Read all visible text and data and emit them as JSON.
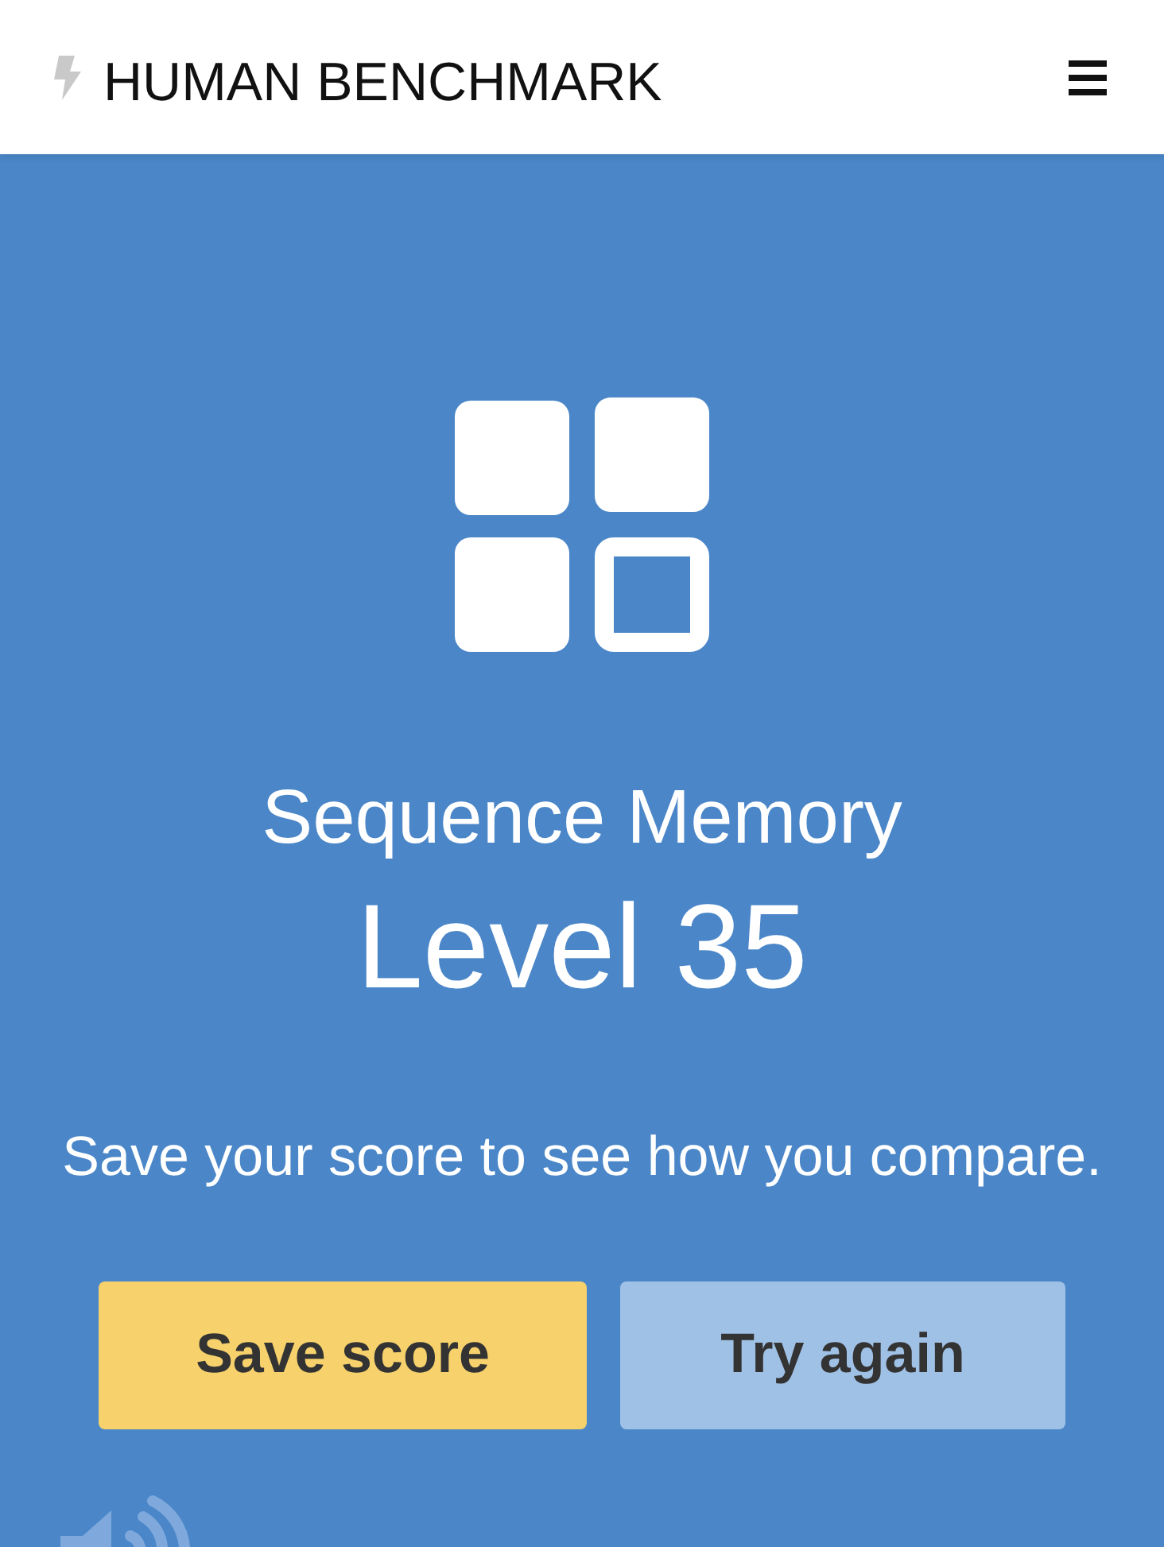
{
  "navbar": {
    "brand": "HUMAN BENCHMARK"
  },
  "result": {
    "test_name": "Sequence Memory",
    "score": "Level 35",
    "prompt": "Save your score to see how you compare."
  },
  "buttons": [
    {
      "label": "Save score",
      "kind": "primary"
    },
    {
      "label": "Try again",
      "kind": "secondary"
    }
  ]
}
